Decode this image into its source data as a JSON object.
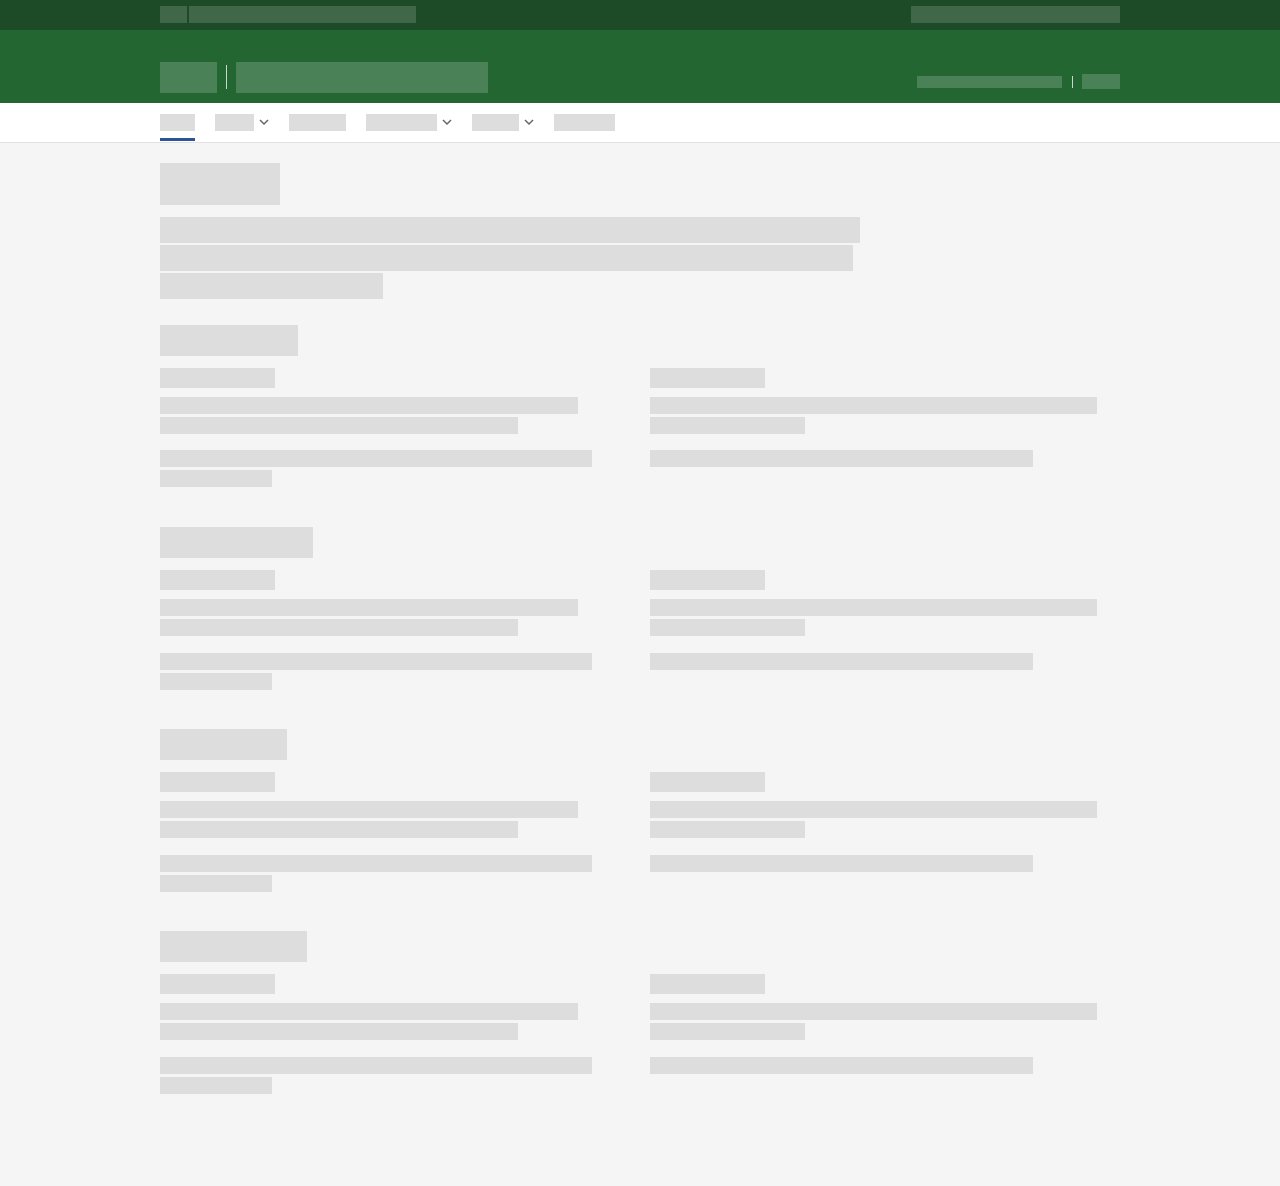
{
  "theme": {
    "top_bar": "#1d4b27",
    "header": "#246632",
    "nav_background": "#ffffff",
    "nav_active_indicator": "#2b5597",
    "page_background": "#f5f5f5",
    "skeleton": "#dddddd"
  },
  "state": "loading-skeleton",
  "nav": {
    "items": [
      {
        "has_dropdown": false,
        "active": true
      },
      {
        "has_dropdown": true,
        "active": false
      },
      {
        "has_dropdown": false,
        "active": false
      },
      {
        "has_dropdown": true,
        "active": false
      },
      {
        "has_dropdown": true,
        "active": false
      },
      {
        "has_dropdown": false,
        "active": false
      }
    ],
    "dropdown_icon": "chevron-down-icon"
  },
  "sections": [
    {
      "columns": 2
    },
    {
      "columns": 2
    },
    {
      "columns": 2
    },
    {
      "columns": 2
    }
  ]
}
